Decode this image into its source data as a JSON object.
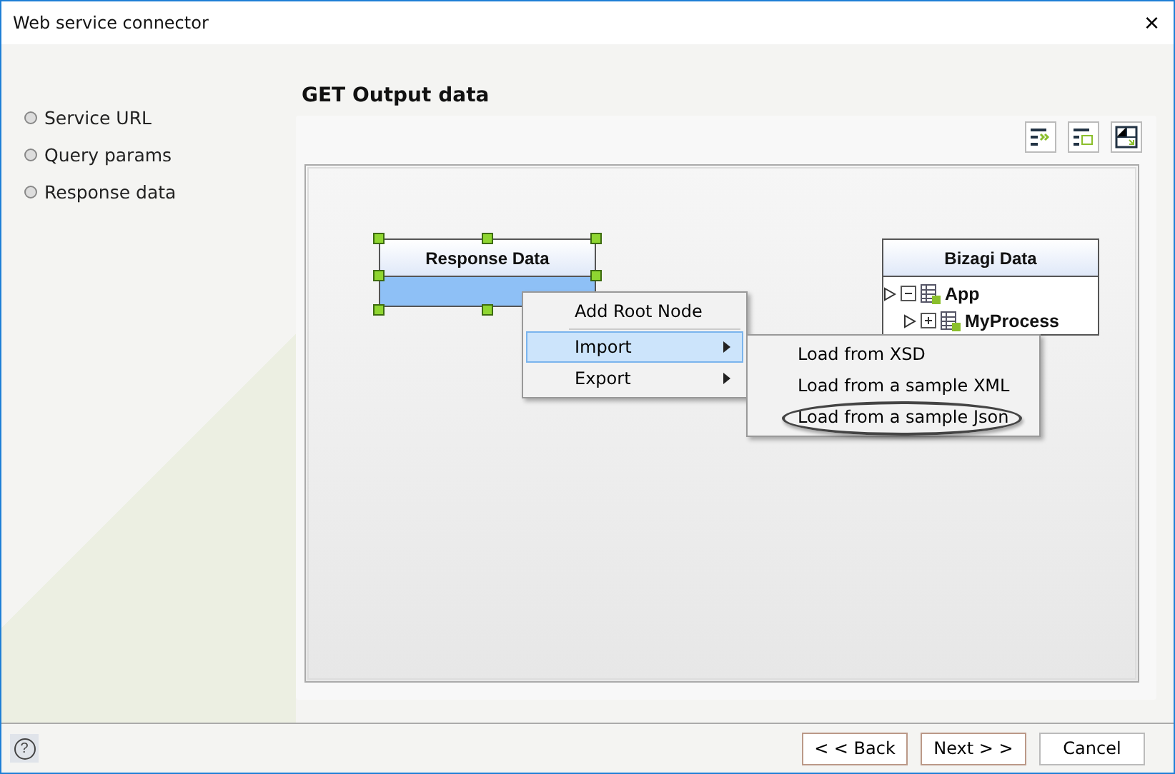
{
  "window": {
    "title": "Web service connector",
    "close": "×"
  },
  "sidebar": {
    "items": [
      {
        "label": "Service URL"
      },
      {
        "label": "Query params"
      },
      {
        "label": "Response data"
      }
    ]
  },
  "heading": "GET Output data",
  "canvas": {
    "source_node": {
      "title": "Response Data",
      "selected": true
    },
    "target_node": {
      "title": "Bizagi Data",
      "tree": [
        {
          "label": "App",
          "expanded": true,
          "children": [
            {
              "label": "MyProcess",
              "expanded": false
            }
          ]
        }
      ]
    },
    "context_menu": [
      {
        "label": "Add Root Node",
        "selected": false,
        "submenu": false
      },
      {
        "label": "Import",
        "selected": true,
        "submenu": true
      },
      {
        "label": "Export",
        "selected": false,
        "submenu": true
      }
    ],
    "submenu": [
      {
        "label": "Load from XSD",
        "highlighted": false
      },
      {
        "label": "Load from a sample XML",
        "highlighted": false
      },
      {
        "label": "Load from a sample Json",
        "highlighted": true
      }
    ]
  },
  "footer": {
    "help": "?",
    "buttons": [
      {
        "label": "< < Back",
        "kind": "back"
      },
      {
        "label": "Next > >",
        "kind": "next"
      },
      {
        "label": "Cancel",
        "kind": "cancel"
      }
    ]
  }
}
